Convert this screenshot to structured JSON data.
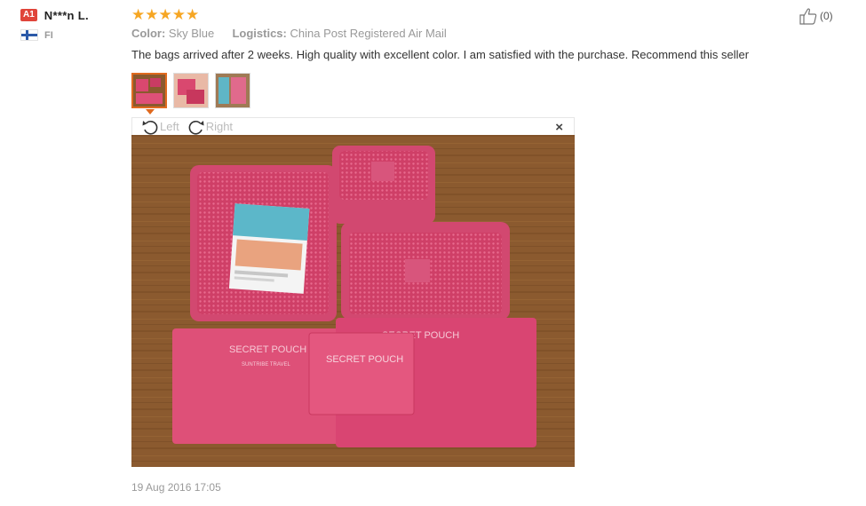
{
  "user": {
    "level": "A1",
    "name": "N***n L.",
    "country": "FI"
  },
  "review": {
    "rating": 5,
    "color_label": "Color:",
    "color_value": "Sky Blue",
    "logistics_label": "Logistics:",
    "logistics_value": "China Post Registered Air Mail",
    "text": "The bags arrived after 2 weeks. High quality with excellent color. I am satisfied with the purchase. Recommend this seller",
    "date": "19 Aug 2016 17:05"
  },
  "helpful": {
    "count": "(0)"
  },
  "viewer": {
    "rotate_left": "Left",
    "rotate_right": "Right",
    "close": "×",
    "photo_text": {
      "pouch_1": "SECRET POUCH",
      "pouch_2": "SECRET POUCH",
      "pouch_3": "SECRET POUCH",
      "pouch_sub": "SUNTRIBE TRAVEL"
    }
  },
  "colors": {
    "star": "#f6a623",
    "badge": "#e0453a",
    "accent": "#e06a1f",
    "pink": "#e0476e"
  },
  "icons": [
    "star-icon",
    "thumbs-up-icon",
    "rotate-left-icon",
    "rotate-right-icon",
    "close-icon",
    "finland-flag-icon"
  ]
}
